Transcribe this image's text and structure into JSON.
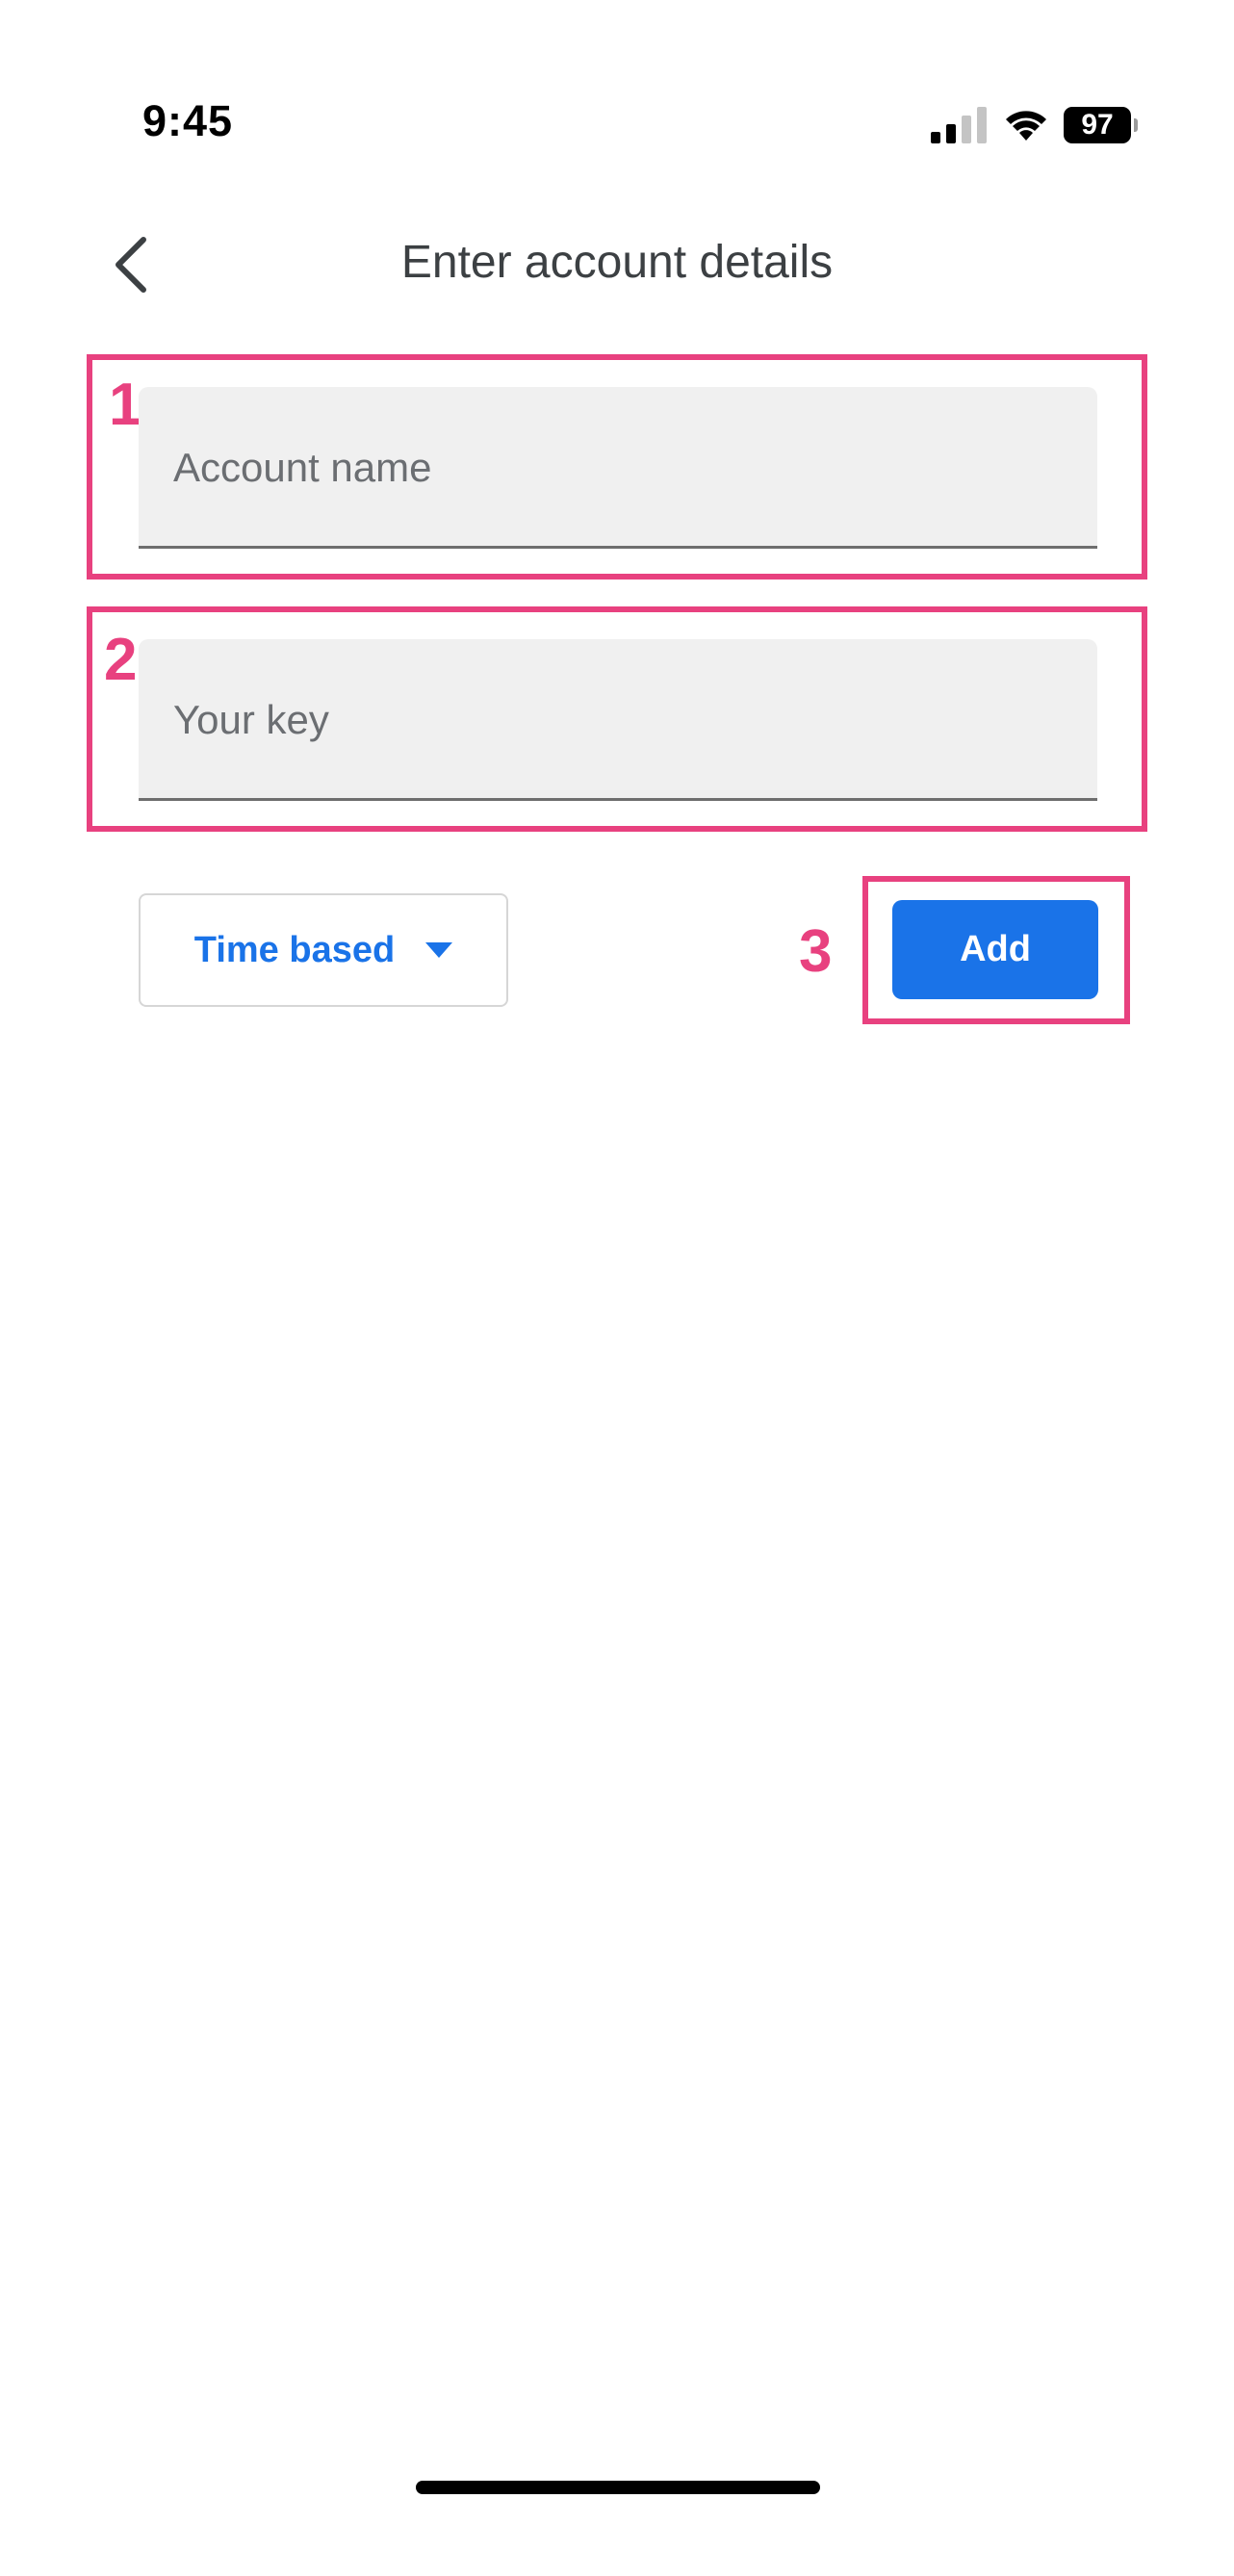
{
  "status_bar": {
    "time": "9:45",
    "battery_level": "97",
    "signal_icon": "cellular-signal-icon",
    "wifi_icon": "wifi-icon"
  },
  "header": {
    "back_icon": "chevron-left-icon",
    "title": "Enter account details"
  },
  "form": {
    "account_name": {
      "placeholder": "Account name",
      "value": ""
    },
    "key": {
      "placeholder": "Your key",
      "value": ""
    },
    "key_type": {
      "selected": "Time based",
      "icon": "dropdown-arrow-icon"
    },
    "add_label": "Add"
  },
  "annotations": {
    "one": "1",
    "two": "2",
    "three": "3"
  },
  "colors": {
    "accent": "#1a73e8",
    "annotation": "#e8417f",
    "field_background": "#f0f0f0",
    "title_text": "#3c4043"
  }
}
